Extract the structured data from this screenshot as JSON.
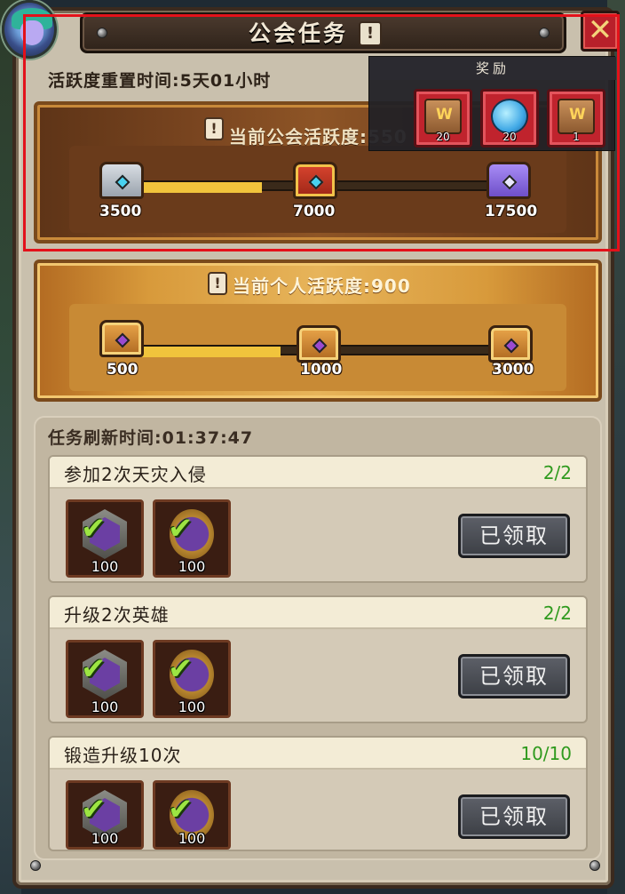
{
  "window": {
    "title": "公会任务",
    "title_badge": "!",
    "close_glyph": "✕"
  },
  "reset": {
    "text": "活跃度重置时间:5天01小时"
  },
  "guild_activity": {
    "label": "当前公会活跃度:550",
    "info_badge": "!",
    "milestones": [
      {
        "value": "3500",
        "chest": "silver-chest-icon"
      },
      {
        "value": "7000",
        "chest": "red-chest-icon"
      },
      {
        "value": "17500",
        "chest": "purple-chest-icon"
      }
    ],
    "progress_fraction": 0.35
  },
  "personal_activity": {
    "label": "当前个人活跃度:900",
    "info_badge": "!",
    "milestones": [
      {
        "value": "500",
        "chest": "open-chest-icon"
      },
      {
        "value": "1000",
        "chest": "gold-chest-icon"
      },
      {
        "value": "3000",
        "chest": "gold-chest-icon"
      }
    ],
    "progress_fraction": 0.4
  },
  "reward_popup": {
    "title": "奖励",
    "items": [
      {
        "icon": "scroll-book-icon",
        "count": "20"
      },
      {
        "icon": "blue-gem-icon",
        "count": "20"
      },
      {
        "icon": "scroll-book-icon",
        "count": "1"
      }
    ]
  },
  "tasks": {
    "refresh_text": "任务刷新时间:01:37:47",
    "items": [
      {
        "name": "参加2次天灾入侵",
        "progress": "2/2",
        "rewards": [
          "100",
          "100"
        ],
        "button": "已领取"
      },
      {
        "name": "升级2次英雄",
        "progress": "2/2",
        "rewards": [
          "100",
          "100"
        ],
        "button": "已领取"
      },
      {
        "name": "锻造升级10次",
        "progress": "10/10",
        "rewards": [
          "100",
          "100"
        ],
        "button": "已领取"
      }
    ]
  },
  "colors": {
    "highlight": "#e3111a",
    "progress_fill": "#f1c43c",
    "completed_progress": "#2f9a1e"
  }
}
